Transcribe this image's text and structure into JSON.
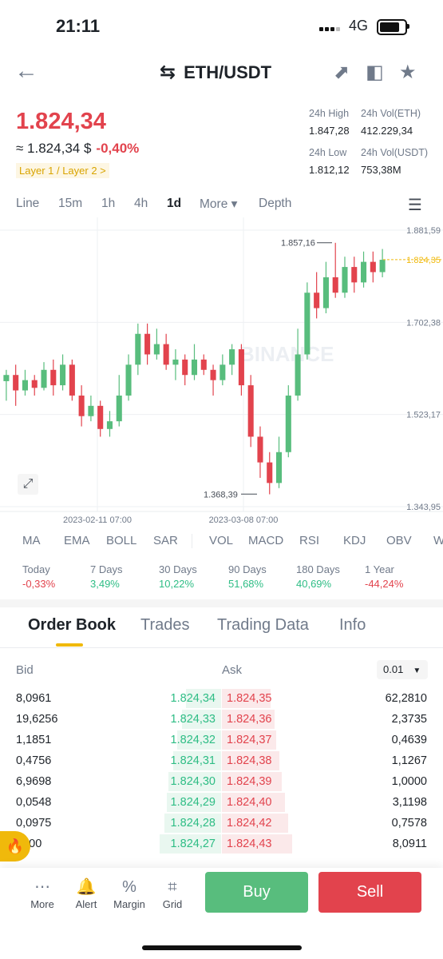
{
  "status": {
    "time": "21:11",
    "network": "4G"
  },
  "header": {
    "pair": "ETH/USDT"
  },
  "price": {
    "last": "1.824,34",
    "approx": "≈ 1.824,34 $",
    "change": "-0,40%",
    "tag": "Layer 1 / Layer 2 >"
  },
  "stats": {
    "high_label": "24h High",
    "high": "1.847,28",
    "vol_eth_label": "24h Vol(ETH)",
    "vol_eth": "412.229,34",
    "low_label": "24h Low",
    "low": "1.812,12",
    "vol_usdt_label": "24h Vol(USDT)",
    "vol_usdt": "753,38M"
  },
  "timeframes": [
    "Line",
    "15m",
    "1h",
    "4h",
    "1d",
    "More ▾",
    "Depth"
  ],
  "chart": {
    "y_ticks": [
      "1.881,59",
      "1.702,38",
      "1.523,17",
      "1.343,95"
    ],
    "current_label": "1.824,35",
    "high_label": "1.857,16",
    "low_label": "1.368,39",
    "x_ticks": [
      "2023-02-11 07:00",
      "2023-03-08 07:00"
    ],
    "watermark": "BINANCE",
    "colors": {
      "up": "#58bd7d",
      "down": "#e2434d",
      "current": "#f0b90b"
    }
  },
  "chart_data": {
    "type": "candlestick",
    "x_ticks": [
      "2023-02-11 07:00",
      "2023-03-08 07:00"
    ],
    "y_ticks": [
      1881.59,
      1702.38,
      1523.17,
      1343.95
    ],
    "ylim": [
      1343.95,
      1881.59
    ],
    "grid": true,
    "annotations": [
      "1.857,16",
      "1.368,39",
      "1.824,35"
    ],
    "candles": [
      [
        1588,
        1600,
        1610,
        1550,
        "up"
      ],
      [
        1600,
        1570,
        1620,
        1540,
        "down"
      ],
      [
        1570,
        1590,
        1610,
        1560,
        "up"
      ],
      [
        1590,
        1575,
        1600,
        1560,
        "down"
      ],
      [
        1575,
        1610,
        1625,
        1570,
        "up"
      ],
      [
        1610,
        1580,
        1630,
        1560,
        "down"
      ],
      [
        1580,
        1620,
        1640,
        1570,
        "up"
      ],
      [
        1620,
        1560,
        1630,
        1550,
        "down"
      ],
      [
        1560,
        1520,
        1580,
        1500,
        "down"
      ],
      [
        1520,
        1540,
        1560,
        1510,
        "up"
      ],
      [
        1540,
        1495,
        1550,
        1480,
        "down"
      ],
      [
        1495,
        1510,
        1530,
        1480,
        "up"
      ],
      [
        1510,
        1560,
        1600,
        1500,
        "up"
      ],
      [
        1560,
        1620,
        1640,
        1550,
        "up"
      ],
      [
        1620,
        1680,
        1700,
        1600,
        "up"
      ],
      [
        1680,
        1640,
        1700,
        1620,
        "down"
      ],
      [
        1640,
        1660,
        1690,
        1630,
        "up"
      ],
      [
        1660,
        1620,
        1680,
        1610,
        "down"
      ],
      [
        1620,
        1630,
        1650,
        1590,
        "up"
      ],
      [
        1630,
        1600,
        1640,
        1580,
        "down"
      ],
      [
        1600,
        1630,
        1660,
        1590,
        "up"
      ],
      [
        1630,
        1610,
        1640,
        1600,
        "down"
      ],
      [
        1610,
        1590,
        1620,
        1560,
        "down"
      ],
      [
        1590,
        1620,
        1640,
        1580,
        "up"
      ],
      [
        1620,
        1650,
        1660,
        1600,
        "up"
      ],
      [
        1650,
        1580,
        1660,
        1560,
        "down"
      ],
      [
        1580,
        1480,
        1600,
        1460,
        "down"
      ],
      [
        1480,
        1430,
        1500,
        1400,
        "down"
      ],
      [
        1430,
        1390,
        1450,
        1368,
        "down"
      ],
      [
        1390,
        1450,
        1480,
        1380,
        "up"
      ],
      [
        1450,
        1560,
        1580,
        1440,
        "up"
      ],
      [
        1560,
        1640,
        1690,
        1550,
        "up"
      ],
      [
        1640,
        1760,
        1780,
        1630,
        "up"
      ],
      [
        1760,
        1730,
        1800,
        1710,
        "down"
      ],
      [
        1730,
        1790,
        1820,
        1720,
        "up"
      ],
      [
        1790,
        1760,
        1857,
        1750,
        "down"
      ],
      [
        1760,
        1810,
        1830,
        1750,
        "up"
      ],
      [
        1810,
        1780,
        1830,
        1760,
        "down"
      ],
      [
        1780,
        1820,
        1840,
        1770,
        "up"
      ],
      [
        1820,
        1800,
        1840,
        1780,
        "down"
      ],
      [
        1800,
        1824,
        1845,
        1790,
        "up"
      ]
    ]
  },
  "indicators": [
    "MA",
    "EMA",
    "BOLL",
    "SAR",
    "VOL",
    "MACD",
    "RSI",
    "KDJ",
    "OBV",
    "W"
  ],
  "performance": [
    {
      "label": "Today",
      "value": "-0,33%",
      "color": "#e2434d"
    },
    {
      "label": "7 Days",
      "value": "3,49%",
      "color": "#2ebd85"
    },
    {
      "label": "30 Days",
      "value": "10,22%",
      "color": "#2ebd85"
    },
    {
      "label": "90 Days",
      "value": "51,68%",
      "color": "#2ebd85"
    },
    {
      "label": "180 Days",
      "value": "40,69%",
      "color": "#2ebd85"
    },
    {
      "label": "1 Year",
      "value": "-44,24%",
      "color": "#e2434d"
    }
  ],
  "tabs": [
    "Order Book",
    "Trades",
    "Trading Data",
    "Info"
  ],
  "orderbook": {
    "bid_label": "Bid",
    "ask_label": "Ask",
    "precision": "0.01",
    "rows": [
      {
        "bq": "8,0961",
        "bp": "1.824,34",
        "ap": "1.824,35",
        "aq": "62,2810",
        "bw": 0.4,
        "aw": 0.55
      },
      {
        "bq": "19,6256",
        "bp": "1.824,33",
        "ap": "1.824,36",
        "aq": "2,3735",
        "bw": 0.45,
        "aw": 0.6
      },
      {
        "bq": "1,1851",
        "bp": "1.824,32",
        "ap": "1.824,37",
        "aq": "0,4639",
        "bw": 0.5,
        "aw": 0.62
      },
      {
        "bq": "0,4756",
        "bp": "1.824,31",
        "ap": "1.824,38",
        "aq": "1,1267",
        "bw": 0.55,
        "aw": 0.65
      },
      {
        "bq": "6,9698",
        "bp": "1.824,30",
        "ap": "1.824,39",
        "aq": "1,0000",
        "bw": 0.6,
        "aw": 0.68
      },
      {
        "bq": "0,0548",
        "bp": "1.824,29",
        "ap": "1.824,40",
        "aq": "3,1198",
        "bw": 0.62,
        "aw": 0.72
      },
      {
        "bq": "0,0975",
        "bp": "1.824,28",
        "ap": "1.824,42",
        "aq": "0,7578",
        "bw": 0.65,
        "aw": 0.75
      },
      {
        "bq": "2000",
        "bp": "1.824,27",
        "ap": "1.824,43",
        "aq": "8,0911",
        "bw": 0.7,
        "aw": 0.8
      }
    ]
  },
  "bottom": {
    "items": [
      "More",
      "Alert",
      "Margin",
      "Grid"
    ],
    "buy": "Buy",
    "sell": "Sell"
  }
}
